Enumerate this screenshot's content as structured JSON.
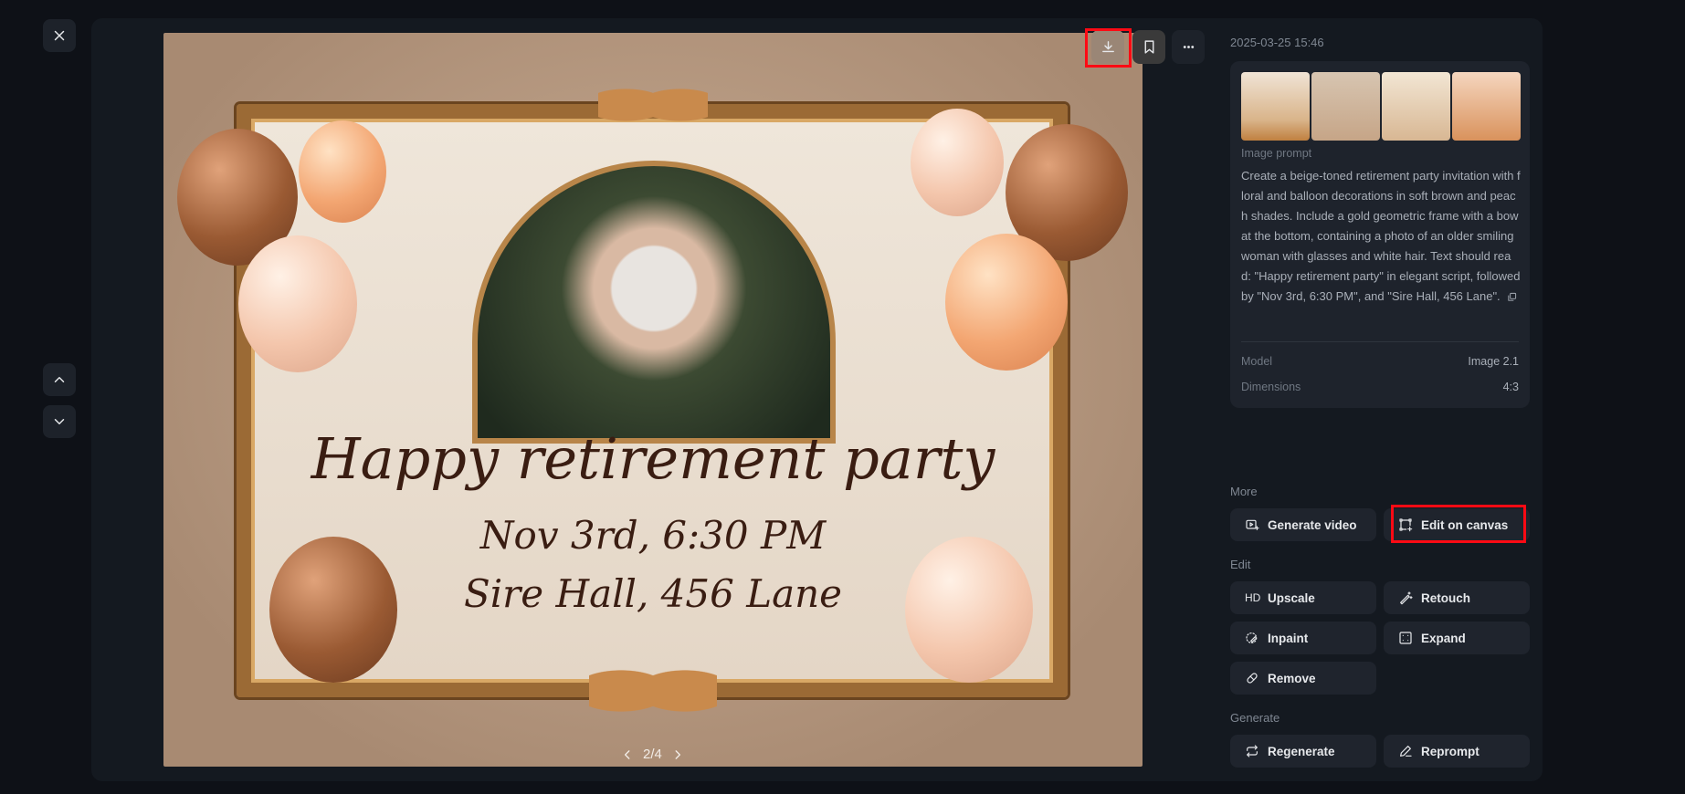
{
  "nav": {
    "close": "close",
    "prev": "previous",
    "next": "next"
  },
  "image": {
    "headline": "Happy retirement party",
    "date_line": "Nov 3rd, 6:30 PM",
    "venue_line": "Sire Hall, 456 Lane",
    "pager": "2/4"
  },
  "toolbar": {
    "download": "Download",
    "bookmark": "Bookmark",
    "more": "More options"
  },
  "panel": {
    "timestamp": "2025-03-25 15:46",
    "prompt_label": "Image prompt",
    "prompt_text": "Create a beige-toned retirement party invitation with floral and balloon decorations in soft brown and peach shades. Include a gold geometric frame with a bow at the bottom, containing a photo of an older smiling woman with glasses and white hair. Text should read: \"Happy retirement party\" in elegant script, followed by \"Nov 3rd, 6:30 PM\", and \"Sire Hall, 456 Lane\".",
    "model_label": "Model",
    "model_value": "Image 2.1",
    "dimensions_label": "Dimensions",
    "dimensions_value": "4:3",
    "sections": {
      "more": "More",
      "edit": "Edit",
      "generate": "Generate"
    },
    "actions": {
      "generate_video": "Generate video",
      "edit_on_canvas": "Edit on canvas",
      "hd": "HD",
      "upscale": "Upscale",
      "retouch": "Retouch",
      "inpaint": "Inpaint",
      "expand": "Expand",
      "remove": "Remove",
      "regenerate": "Regenerate",
      "reprompt": "Reprompt"
    }
  },
  "colors": {
    "highlight": "#ff0a14",
    "background": "#0e1117",
    "panel": "#1e232c"
  }
}
